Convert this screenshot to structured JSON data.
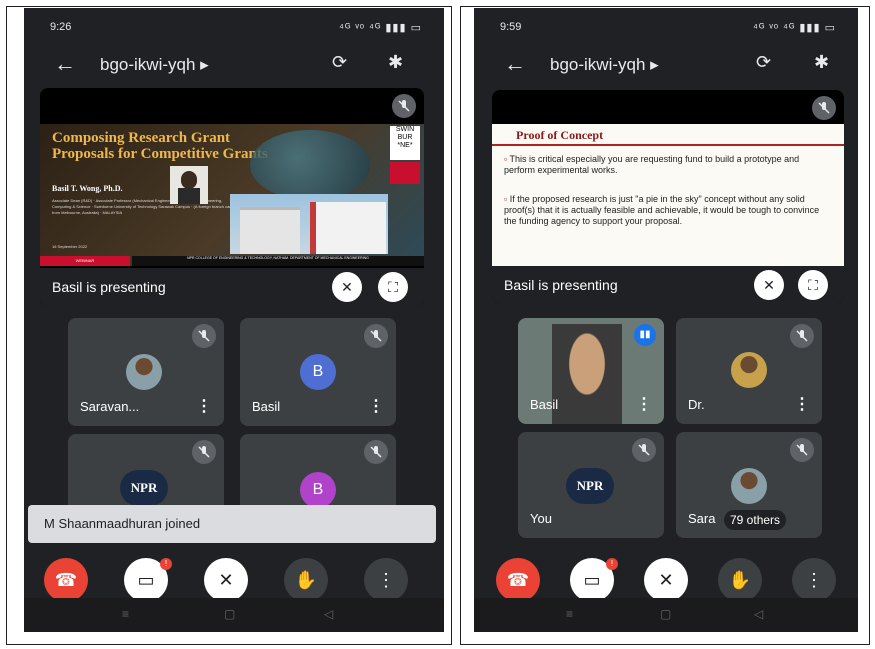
{
  "left": {
    "status": {
      "time": "9:26",
      "icons_right": "⁴ᴳ ᵛᵒ ⁴ᴳ ▮▮▮ ▭"
    },
    "meeting_code": "bgo-ikwi-yqh",
    "meeting_code_chevron": "▸",
    "slide": {
      "title": "Composing Research Grant Proposals for Competitive Grants",
      "author": "Basil T. Wong, Ph.D.",
      "details": "Associate Dean (R&D) · Associate Professor (Mechanical Engineering) · Faculty of Engineering, Computing & Science · Swinburne University of Technology Sarawak Campus · (A foreign branch campus from Melbourne, Australia) · MALAYSIA",
      "date": "16 September 2022",
      "footer_left": "WEBINAR",
      "footer_right": "NPR COLLEGE OF ENGINEERING & TECHNOLOGY, NATHAM. DEPARTMENT OF MECHANICAL ENGINEERING",
      "logo": "SWIN BUR *NE*"
    },
    "presenting_label": "Basil is presenting",
    "tiles": [
      {
        "name": "Saravan...",
        "avatar": "photo"
      },
      {
        "name": "Basil",
        "avatar_letter": "B",
        "avatar_color": "#4f6ed4"
      },
      {
        "name": "",
        "avatar": "NPR",
        "avatar_text": "NPR"
      },
      {
        "name": "",
        "avatar_letter": "B",
        "avatar_color": "#b043c9"
      }
    ],
    "toast": "M Shaanmaadhuran joined",
    "camera_badge": "!"
  },
  "right": {
    "status": {
      "time": "9:59",
      "icons_right": "⁴ᴳ ᵛᵒ ⁴ᴳ ▮▮▮ ▭"
    },
    "meeting_code": "bgo-ikwi-yqh",
    "meeting_code_chevron": "▸",
    "slide": {
      "title": "Proof of Concept",
      "bullet1": "This is critical especially you are requesting fund to build a prototype and perform experimental works.",
      "bullet2": "If the proposed research is just \"a pie in the sky\" concept without any solid proof(s) that it is actually feasible and achievable, it would be tough to convince the funding agency to support your proposal."
    },
    "presenting_label": "Basil is presenting",
    "tiles": [
      {
        "name": "Basil",
        "avatar": "video"
      },
      {
        "name": "Dr.",
        "avatar": "photo"
      },
      {
        "name": "You",
        "avatar": "NPR",
        "avatar_text": "NPR"
      },
      {
        "name": "Sara",
        "avatar": "photo",
        "overlay": "79 others"
      }
    ],
    "camera_badge": "!"
  },
  "colors": {
    "bg": "#202124",
    "tile": "#3c4043",
    "end_call": "#ea4335",
    "presenter_bg": "#000000"
  }
}
